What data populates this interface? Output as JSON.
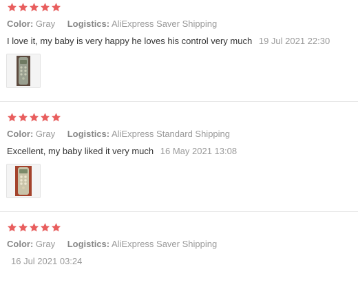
{
  "colors": {
    "star": "#e85e5e",
    "label": "#888888",
    "value": "#999999",
    "text": "#333333",
    "divider": "#e8e8e8"
  },
  "reviews": [
    {
      "stars": 5,
      "color_label": "Color:",
      "color_value": "Gray",
      "logistics_label": "Logistics:",
      "logistics_value": "AliExpress Saver Shipping",
      "text": "I love it, my baby is very happy he loves his control very much",
      "date": "19 Jul 2021 22:30",
      "has_photo": true,
      "photo_icon": "toy-remote-photo"
    },
    {
      "stars": 5,
      "color_label": "Color:",
      "color_value": "Gray",
      "logistics_label": "Logistics:",
      "logistics_value": "AliExpress Standard Shipping",
      "text": "Excellent, my baby liked it very much",
      "date": "16 May 2021 13:08",
      "has_photo": true,
      "photo_icon": "toy-remote-photo"
    },
    {
      "stars": 5,
      "color_label": "Color:",
      "color_value": "Gray",
      "logistics_label": "Logistics:",
      "logistics_value": "AliExpress Saver Shipping",
      "text": "",
      "date": "16 Jul 2021 03:24",
      "has_photo": false
    }
  ]
}
